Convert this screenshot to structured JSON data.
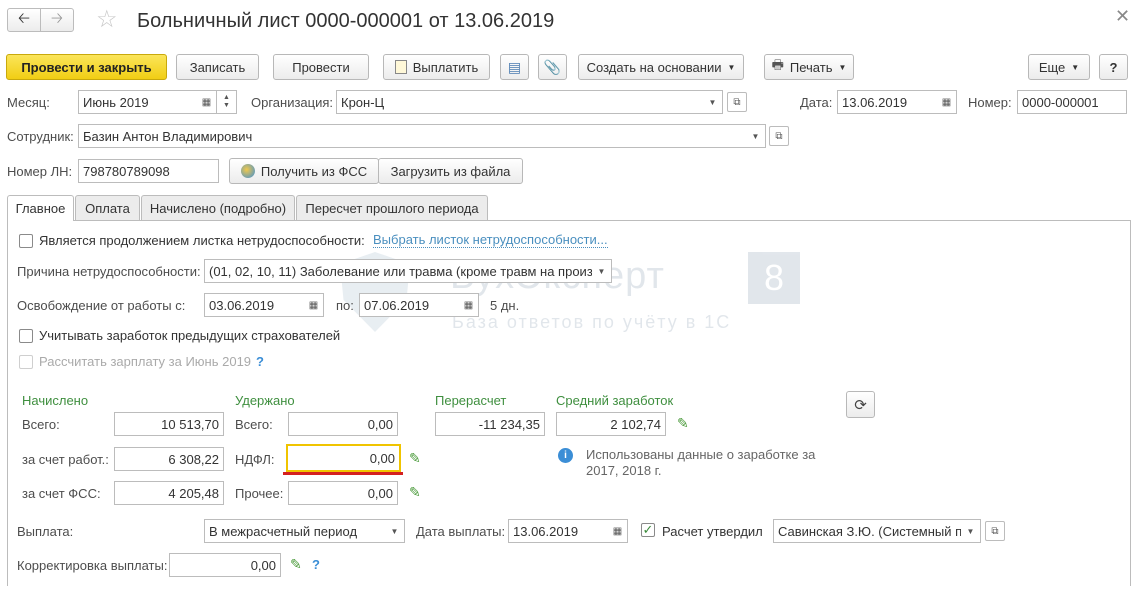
{
  "window": {
    "title": "Больничный лист 0000-000001 от 13.06.2019"
  },
  "toolbar": {
    "post_close": "Провести и закрыть",
    "save": "Записать",
    "post": "Провести",
    "pay": "Выплатить",
    "create_based": "Создать на основании",
    "print": "Печать",
    "more": "Еще",
    "help": "?"
  },
  "header": {
    "month_label": "Месяц:",
    "month_value": "Июнь 2019",
    "org_label": "Организация:",
    "org_value": "Крон-Ц",
    "date_label": "Дата:",
    "date_value": "13.06.2019",
    "number_label": "Номер:",
    "number_value": "0000-000001",
    "employee_label": "Сотрудник:",
    "employee_value": "Базин Антон Владимирович",
    "ln_label": "Номер ЛН:",
    "ln_value": "798780789098",
    "get_fss": "Получить из ФСС",
    "load_file": "Загрузить из файла"
  },
  "tabs": [
    {
      "label": "Главное"
    },
    {
      "label": "Оплата"
    },
    {
      "label": "Начислено (подробно)"
    },
    {
      "label": "Пересчет прошлого периода"
    }
  ],
  "main": {
    "continuation_label": "Является продолжением листка нетрудоспособности:",
    "continuation_link": "Выбрать листок нетрудоспособности...",
    "reason_label": "Причина нетрудоспособности:",
    "reason_value": "(01, 02, 10, 11) Заболевание или травма (кроме травм на произв",
    "release_label": "Освобождение от работы с:",
    "release_from": "03.06.2019",
    "release_to_label": "по:",
    "release_to": "07.06.2019",
    "days": "5 дн.",
    "prev_insurers_label": "Учитывать заработок предыдущих страхователей",
    "calc_salary_label": "Рассчитать зарплату за Июнь 2019",
    "help_q": "?"
  },
  "calc": {
    "accrued_title": "Начислено",
    "withheld_title": "Удержано",
    "recalc_title": "Перерасчет",
    "avg_title": "Средний заработок",
    "total_label": "Всего:",
    "employer_label": "за счет работ.:",
    "fss_label": "за счет ФСС:",
    "accrued_total": "10 513,70",
    "accrued_employer": "6 308,22",
    "accrued_fss": "4 205,48",
    "withheld_total_label": "Всего:",
    "ndfl_label": "НДФЛ:",
    "other_label": "Прочее:",
    "withheld_total": "0,00",
    "ndfl": "0,00",
    "other": "0,00",
    "recalc_value": "-11 234,35",
    "avg_value": "2 102,74",
    "info_text_1": "Использованы данные о заработке за",
    "info_text_2": "2017,  2018 г."
  },
  "payment": {
    "payout_label": "Выплата:",
    "payout_value": "В межрасчетный период",
    "payout_date_label": "Дата выплаты:",
    "payout_date": "13.06.2019",
    "approved_label": "Расчет утвердил",
    "approved_value": "Савинская З.Ю. (Системный п",
    "correction_label": "Корректировка выплаты:",
    "correction_value": "0,00"
  },
  "watermark": {
    "brand": "БухЭксперт",
    "version": "8",
    "tagline": "База ответов по учёту в 1С"
  },
  "colors": {
    "primary_button": "#f1ce14",
    "label_green": "#3f8f3f",
    "link_blue": "#4a8fbf",
    "active_field_border": "#f0c400",
    "underline_red": "#d42020"
  }
}
